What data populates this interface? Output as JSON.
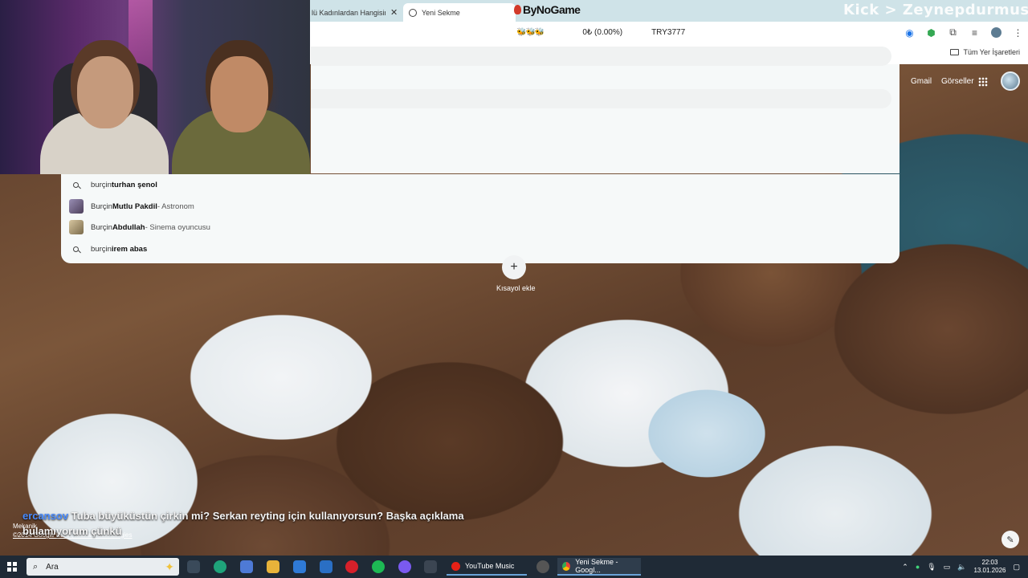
{
  "browser": {
    "tabs": [
      {
        "label": "lü Kadınlardan Hangisinin",
        "active": false
      },
      {
        "label": "Yeni Sekme",
        "active": true
      }
    ],
    "bookmarks_all": "Tüm Yer İşaretleri"
  },
  "overlay": {
    "logo": "ByNoGame",
    "channel": "Kick > Zeynepdurmus",
    "ticker": {
      "emotes": "🐝🐝🐝",
      "percent": "0₺ (0.00%)",
      "code": "TRY3777"
    },
    "chat_user": "ercansov",
    "chat_text": "Tuba büyüküstün çirkin mi? Serkan reyting için kullanıyorsun? Başka açıklama bulamıyorum çünkü"
  },
  "ntp": {
    "gmail": "Gmail",
    "images": "Görseller",
    "shortcut_label": "Kısayol ekle",
    "credit_line1": "Mekanik",
    "credit_line2": "©2014 Google Earth, Maxar Technologies"
  },
  "suggestions": [
    {
      "prefix": "burçin ",
      "bold": "turhan şenol",
      "desc": "",
      "kind": "search",
      "icon": "search-icon"
    },
    {
      "prefix": "Burçin ",
      "bold": "Mutlu Pakdil",
      "desc": " - Astronom",
      "kind": "entity",
      "icon": "thumbnail"
    },
    {
      "prefix": "Burçin ",
      "bold": "Abdullah",
      "desc": " - Sinema oyuncusu",
      "kind": "entity",
      "icon": "thumbnail"
    },
    {
      "prefix": "burçin ",
      "bold": "irem abas",
      "desc": "",
      "kind": "search",
      "icon": "search-icon"
    }
  ],
  "taskbar": {
    "search_placeholder": "Ara",
    "task_youtube": "YouTube Music",
    "task_chrome": "Yeni Sekme - Googl...",
    "time": "22:03",
    "date": "13.01.2026"
  },
  "colors": {
    "accent": "#1a73e8",
    "taskbar": "#1f2a36",
    "chat_user": "#4a8cff"
  }
}
